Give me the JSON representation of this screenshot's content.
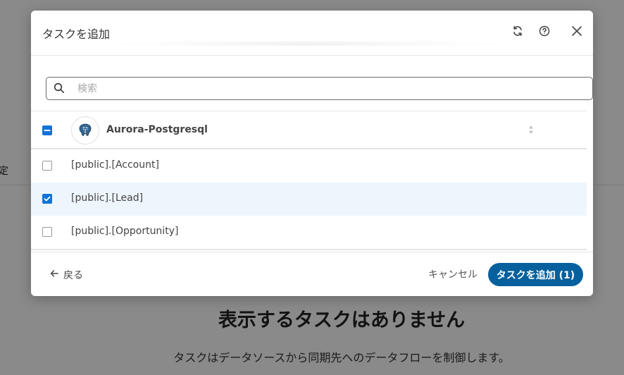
{
  "background": {
    "edge_text": "定",
    "empty_title": "表示するタスクはありません",
    "empty_description": "タスクはデータソースから同期先へのデータフローを制御します。"
  },
  "modal": {
    "title": "タスクを追加",
    "icons": {
      "refresh": "refresh-icon",
      "help": "help-icon",
      "close": "close-icon"
    },
    "search": {
      "placeholder": "検索",
      "value": ""
    },
    "group": {
      "label": "Aurora-Postgresql",
      "state": "indeterminate",
      "icon": "postgresql-icon"
    },
    "items": [
      {
        "label": "[public].[Account]",
        "checked": false
      },
      {
        "label": "[public].[Lead]",
        "checked": true
      },
      {
        "label": "[public].[Opportunity]",
        "checked": false
      }
    ],
    "footer": {
      "back_label": "戻る",
      "cancel_label": "キャンセル",
      "add_label": "タスクを追加 (1)"
    }
  },
  "colors": {
    "accent": "#1273d8",
    "primary_button": "#06609e",
    "selected_row": "#eef6fd"
  }
}
